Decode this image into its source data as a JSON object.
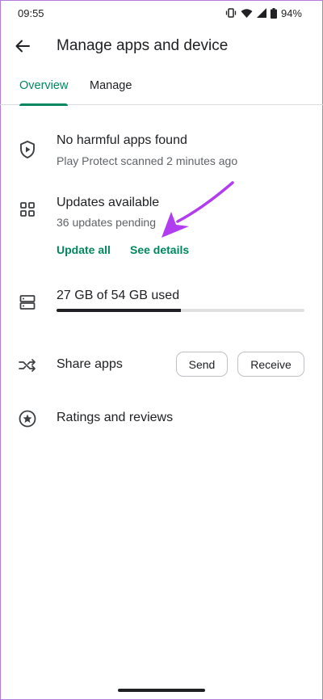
{
  "status_bar": {
    "time": "09:55",
    "battery": "94%"
  },
  "app_bar": {
    "title": "Manage apps and device",
    "back_icon": "arrow-back-icon"
  },
  "tabs": [
    {
      "label": "Overview",
      "active": true
    },
    {
      "label": "Manage",
      "active": false
    }
  ],
  "protect": {
    "icon": "shield-play-icon",
    "title": "No harmful apps found",
    "subtitle": "Play Protect scanned 2 minutes ago"
  },
  "updates": {
    "icon": "apps-grid-icon",
    "title": "Updates available",
    "subtitle": "36 updates pending",
    "update_all_label": "Update all",
    "see_details_label": "See details"
  },
  "storage": {
    "icon": "storage-icon",
    "label": "27 GB of 54 GB used",
    "used_gb": 27,
    "total_gb": 54,
    "used_fraction": 0.5
  },
  "share": {
    "icon": "share-arrows-icon",
    "label": "Share apps",
    "send_label": "Send",
    "receive_label": "Receive"
  },
  "ratings": {
    "icon": "star-circle-icon",
    "label": "Ratings and reviews"
  },
  "colors": {
    "accent": "#01875f",
    "annotation_arrow": "#b13cf0",
    "text_primary": "#202124",
    "text_secondary": "#5f6368"
  }
}
